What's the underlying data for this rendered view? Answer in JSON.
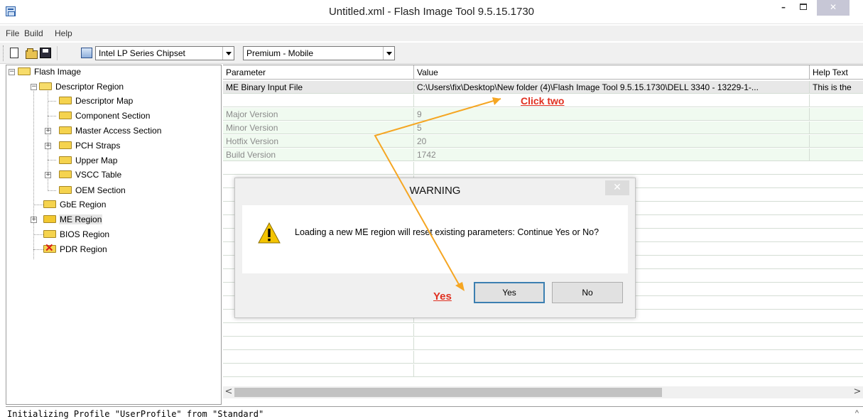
{
  "window": {
    "title": "Untitled.xml - Flash Image Tool 9.5.15.1730",
    "minimize_glyph": "–",
    "close_glyph": "✕"
  },
  "menu": [
    "File",
    "Build",
    "Help"
  ],
  "toolbar": {
    "chipset_select": "Intel LP Series Chipset",
    "sku_select": "Premium - Mobile",
    "icons": [
      "new-file-icon",
      "open-folder-icon",
      "save-disk-icon",
      "chipset-icon"
    ]
  },
  "tree": {
    "root": "Flash Image",
    "descriptor": "Descriptor Region",
    "descriptor_children": [
      "Descriptor Map",
      "Component Section",
      "Master Access Section",
      "PCH Straps",
      "Upper Map",
      "VSCC Table",
      "OEM Section"
    ],
    "gbe": "GbE Region",
    "me": "ME Region",
    "bios": "BIOS Region",
    "pdr": "PDR Region"
  },
  "grid": {
    "headers": [
      "Parameter",
      "Value",
      "Help Text"
    ],
    "rows": [
      {
        "param": "ME Binary Input File",
        "value": "C:\\Users\\fix\\Desktop\\New folder (4)\\Flash Image Tool 9.5.15.1730\\DELL 3340 - 13229-1-...",
        "help": "This is the"
      },
      {
        "param": "",
        "value": "",
        "help": ""
      },
      {
        "param": "Major Version",
        "value": "9",
        "help": ""
      },
      {
        "param": "Minor Version",
        "value": "5",
        "help": ""
      },
      {
        "param": "Hotfix Version",
        "value": "20",
        "help": ""
      },
      {
        "param": "Build Version",
        "value": "1742",
        "help": ""
      }
    ]
  },
  "dialog": {
    "title": "WARNING",
    "message": "Loading a new ME region will reset existing parameters:  Continue Yes or No?",
    "yes_label": "Yes",
    "no_label": "No",
    "close_glyph": "✕"
  },
  "annotations": {
    "click_two": "Click two",
    "yes": "Yes",
    "color": "#e03020",
    "arrow_color": "#f5a623"
  },
  "status": {
    "text": "Initializing Profile \"UserProfile\" from \"Standard\"",
    "scroll_up": "^"
  },
  "scroll": {
    "left": "<",
    "right": ">"
  }
}
